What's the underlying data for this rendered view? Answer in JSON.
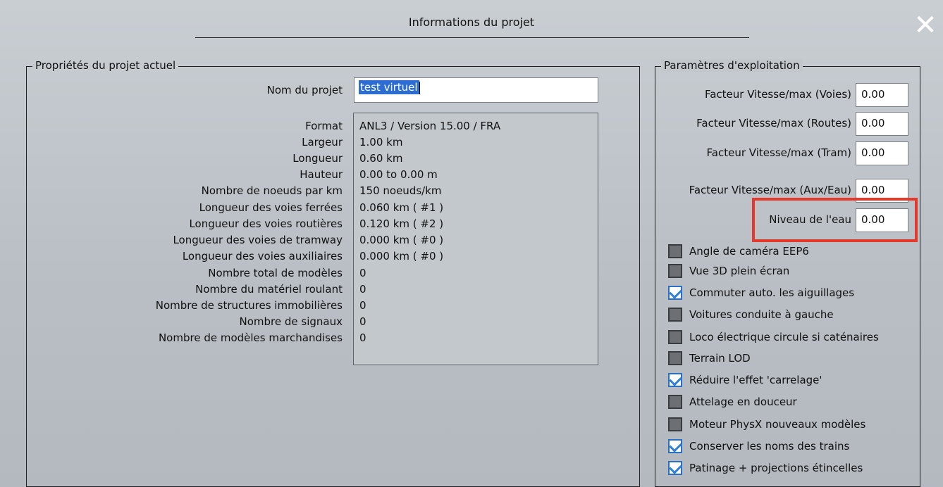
{
  "dialog": {
    "title": "Informations du projet",
    "close_label": "✕"
  },
  "project": {
    "group_title": "Propriétés du projet actuel",
    "name_label": "Nom du projet",
    "name_value": "test virtuel",
    "properties": [
      {
        "label": "Format",
        "value": "ANL3 / Version 15.00 / FRA"
      },
      {
        "label": "Largeur",
        "value": "1.00 km"
      },
      {
        "label": "Longueur",
        "value": "0.60 km"
      },
      {
        "label": "Hauteur",
        "value": "0.00 to 0.00 m"
      },
      {
        "label": "Nombre de noeuds par km",
        "value": "150 noeuds/km"
      },
      {
        "label": "Longueur des voies ferrées",
        "value": "0.060 km ( #1 )"
      },
      {
        "label": "Longueur des voies routières",
        "value": "0.120 km ( #2 )"
      },
      {
        "label": "Longueur des voies de tramway",
        "value": "0.000 km ( #0 )"
      },
      {
        "label": "Longueur des voies auxiliaires",
        "value": "0.000 km ( #0 )"
      },
      {
        "label": "Nombre total de modèles",
        "value": "0"
      },
      {
        "label": "Nombre du matériel roulant",
        "value": "0"
      },
      {
        "label": "Nombre de structures immobilières",
        "value": "0"
      },
      {
        "label": "Nombre de signaux",
        "value": "0"
      },
      {
        "label": "Nombre de modèles marchandises",
        "value": "0"
      }
    ]
  },
  "exploitation": {
    "group_title": "Paramètres d'exploitation",
    "fields": [
      {
        "label": "Facteur Vitesse/max (Voies)",
        "value": "0.00"
      },
      {
        "label": "Facteur Vitesse/max (Routes)",
        "value": "0.00"
      },
      {
        "label": "Facteur Vitesse/max (Tram)",
        "value": "0.00"
      },
      {
        "label": "Facteur Vitesse/max (Aux/Eau)",
        "value": "0.00"
      },
      {
        "label": "Niveau de l'eau",
        "value": "0.00"
      }
    ],
    "checkboxes": [
      {
        "label": "Angle de caméra EEP6",
        "checked": false
      },
      {
        "label": "Vue 3D plein écran",
        "checked": false
      },
      {
        "label": "Commuter auto. les aiguillages",
        "checked": true
      },
      {
        "label": "Voitures conduite à gauche",
        "checked": false
      },
      {
        "label": "Loco électrique circule si caténaires",
        "checked": false
      },
      {
        "label": "Terrain LOD",
        "checked": false
      },
      {
        "label": "Réduire l'effet 'carrelage'",
        "checked": true
      },
      {
        "label": "Attelage en douceur",
        "checked": false
      },
      {
        "label": "Moteur PhysX nouveaux modèles",
        "checked": false
      },
      {
        "label": "Conserver les noms des trains",
        "checked": true
      },
      {
        "label": "Patinage + projections étincelles",
        "checked": true
      }
    ],
    "highlight_color": "#e43a2e"
  }
}
